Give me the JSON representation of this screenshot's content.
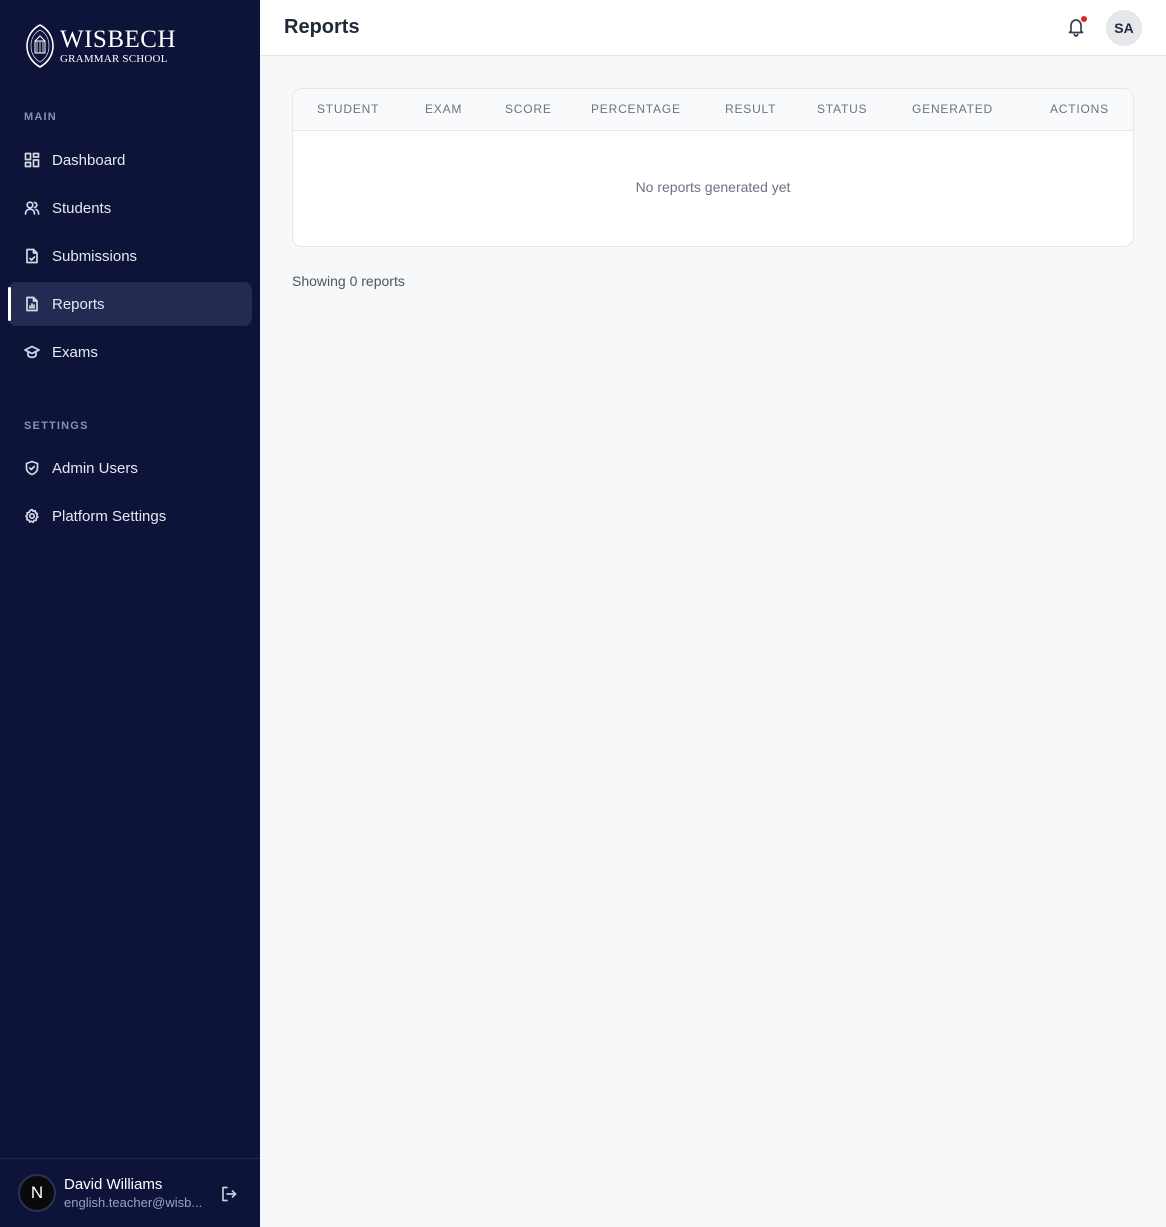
{
  "brand": {
    "line1": "WISBECH",
    "line2": "GRAMMAR SCHOOL"
  },
  "sidebar": {
    "sections": [
      {
        "label": "MAIN"
      },
      {
        "label": "SETTINGS"
      }
    ],
    "items": [
      {
        "label": "Dashboard",
        "icon": "dashboard-icon"
      },
      {
        "label": "Students",
        "icon": "users-icon"
      },
      {
        "label": "Submissions",
        "icon": "document-icon"
      },
      {
        "label": "Reports",
        "icon": "report-icon",
        "active": true
      },
      {
        "label": "Exams",
        "icon": "graduation-cap-icon"
      },
      {
        "label": "Admin Users",
        "icon": "shield-icon"
      },
      {
        "label": "Platform Settings",
        "icon": "gear-icon"
      }
    ]
  },
  "user": {
    "initial": "N",
    "name": "David Williams",
    "email": "english.teacher@wisb..."
  },
  "header": {
    "title": "Reports",
    "avatar_initials": "SA"
  },
  "table": {
    "columns": [
      "STUDENT",
      "EXAM",
      "SCORE",
      "PERCENTAGE",
      "RESULT",
      "STATUS",
      "GENERATED",
      "ACTIONS"
    ],
    "empty_message": "No reports generated yet"
  },
  "footer": {
    "text": "Showing 0 reports"
  },
  "colors": {
    "sidebar_bg": "#0d1339",
    "active_item_bg": "#242b52",
    "notification_dot": "#dc2626"
  }
}
